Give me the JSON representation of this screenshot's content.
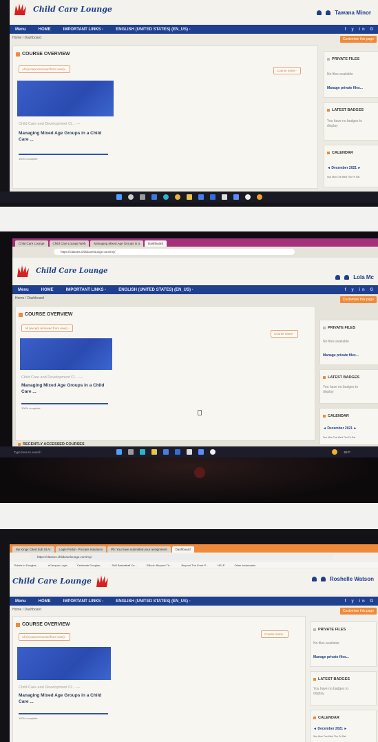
{
  "site": {
    "logo_text": "Child Care Lounge",
    "nav": [
      "Menu",
      "HOME",
      "IMPORTANT LINKS -",
      "ENGLISH (UNITED STATES) (EN_US) -"
    ],
    "crumb": "Home / Dashboard",
    "customise": "Customise this page",
    "social": "f y in G"
  },
  "course_overview": {
    "title": "COURSE OVERVIEW",
    "filter": "All (except removed from view) -",
    "sort": "Course name -",
    "course_category": "Child Care and Development Cl... —",
    "course_name": "Managing Mixed Age Groups in a Child Care ...",
    "progress_label": "100% complete",
    "progress": 1.0
  },
  "sidebar": {
    "private_files_title": "PRIVATE FILES",
    "no_files": "No files available",
    "manage_files": "Manage private files...",
    "latest_badges_title": "LATEST BADGES",
    "no_badges": "You have no badges to display",
    "calendar_title": "CALENDAR",
    "calendar_month": "◄  December 2021  ►",
    "calendar_days": "Sun Mon Tue Wed Thu Fri Sat"
  },
  "photos": [
    {
      "user_name": "Tawana Minor"
    },
    {
      "user_name": "Lola Mc",
      "address": "https://classes.childcarelounge.com/my/",
      "tabs": [
        "Child Care Lounge",
        "Child Care Lounge Web",
        "Managing Mixed Age Groups in a",
        "Dashboard"
      ],
      "recent_courses": "RECENTLY ACCESSED COURSES",
      "search": "Type here to search",
      "weather": "55°F"
    },
    {
      "user_name": "Roshelle Watson",
      "address": "https://classes.childcarelounge.com/my/",
      "tabs": [
        "My Kings Cited Sub St Ar",
        "Login Portal - Procare Solutions",
        "Pb: You have submitted your assignment",
        "Dashboard"
      ],
      "bookmarks": [
        "Tickets in Douglas...",
        "eCampus Login",
        "Celebrate Douglas...",
        "Skill Basketball Ca...",
        "EBook: Beyond Th...",
        "Beyond The Front P...",
        "HELP",
        "Other bookmarks"
      ]
    }
  ],
  "colors": {
    "nav_blue": "#1f3f8f",
    "accent_orange": "#f08a3a",
    "course_blue": "#2f53b8"
  }
}
